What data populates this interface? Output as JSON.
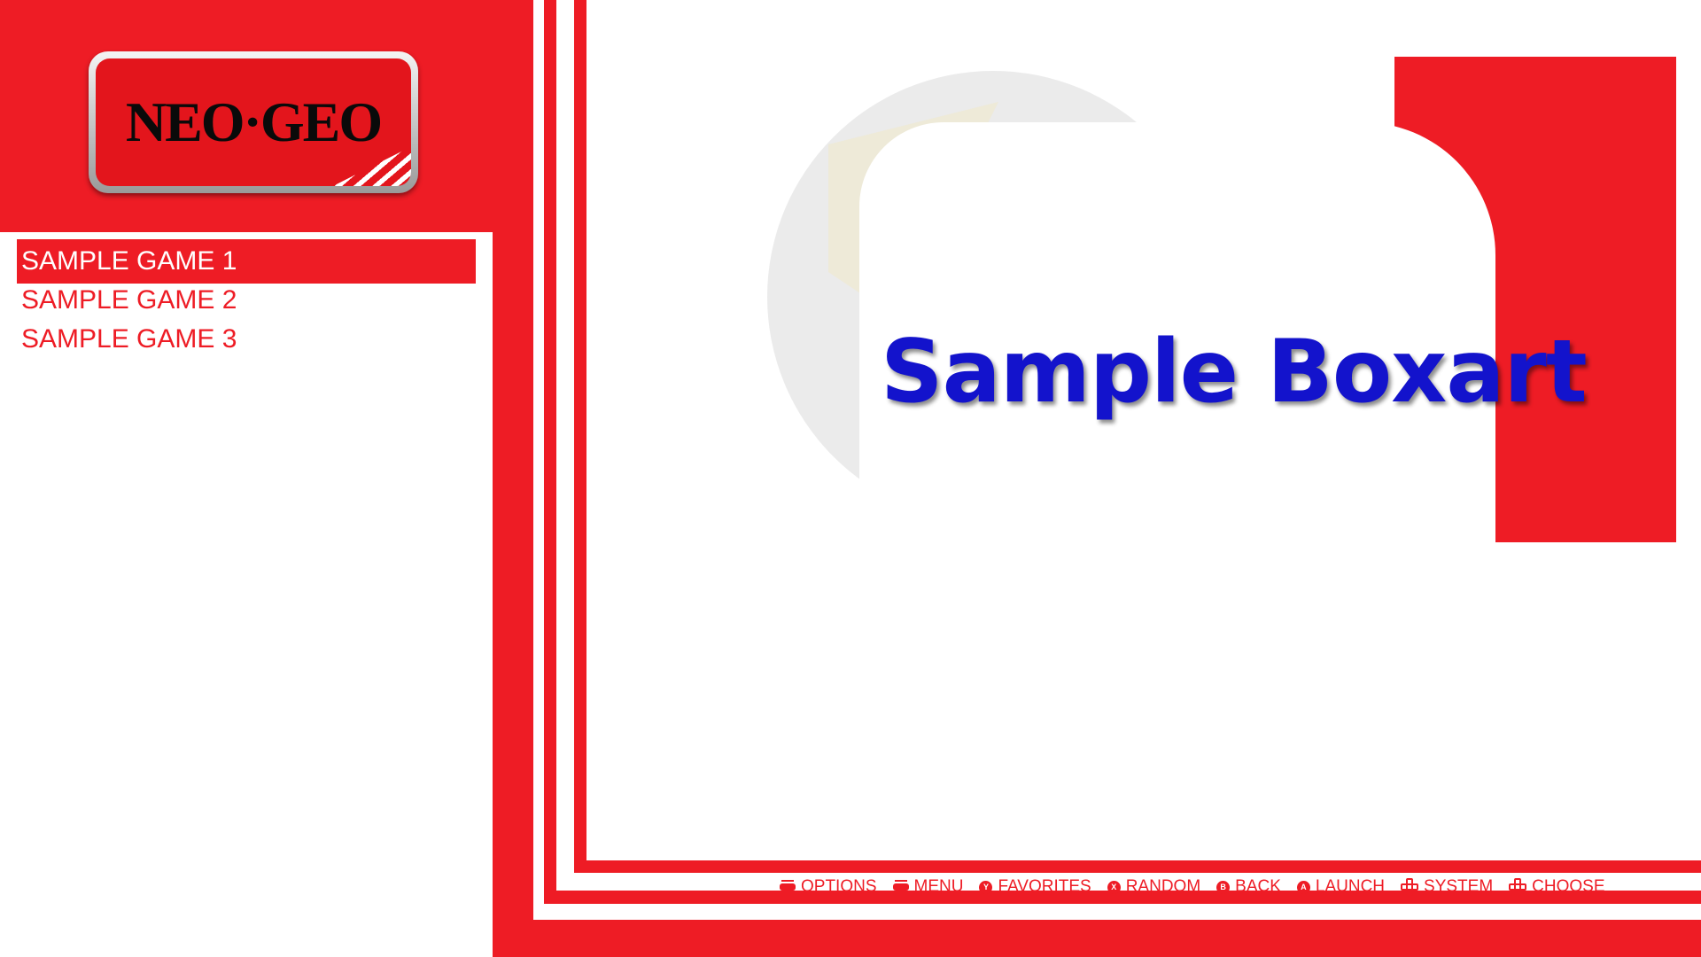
{
  "logo": {
    "text": "NEO·GEO"
  },
  "game_list": {
    "items": [
      {
        "label": "SAMPLE GAME 1",
        "selected": true
      },
      {
        "label": "SAMPLE GAME 2",
        "selected": false
      },
      {
        "label": "SAMPLE GAME 3",
        "selected": false
      }
    ]
  },
  "boxart": {
    "text": "Sample Boxart"
  },
  "help": {
    "items": [
      {
        "icon": "select-button-icon",
        "label": "OPTIONS"
      },
      {
        "icon": "start-button-icon",
        "label": "MENU"
      },
      {
        "icon": "y-button-icon",
        "glyph": "Y",
        "label": "FAVORITES"
      },
      {
        "icon": "x-button-icon",
        "glyph": "X",
        "label": "RANDOM"
      },
      {
        "icon": "b-button-icon",
        "glyph": "B",
        "label": "BACK"
      },
      {
        "icon": "a-button-icon",
        "glyph": "A",
        "label": "LAUNCH"
      },
      {
        "icon": "dpad-horizontal-icon",
        "label": "SYSTEM"
      },
      {
        "icon": "dpad-vertical-icon",
        "label": "CHOOSE"
      }
    ]
  },
  "colors": {
    "accent": "#ee1c25",
    "boxart_text": "#1313cc",
    "background": "#ffffff"
  }
}
